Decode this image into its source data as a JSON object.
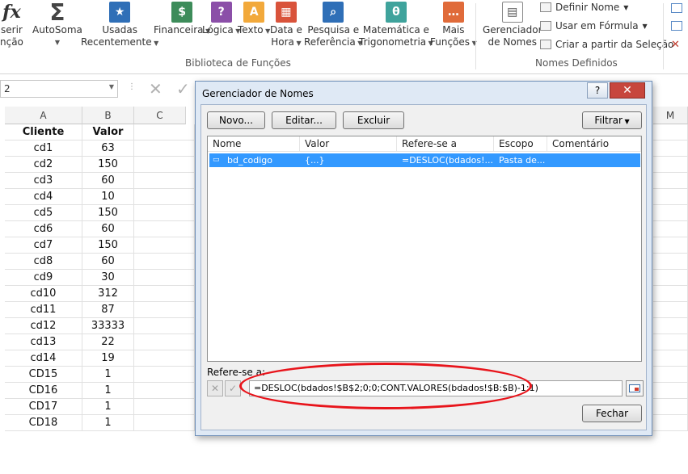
{
  "ribbon": {
    "insert_function": {
      "line1": "serir",
      "line2": "nção"
    },
    "autosum": {
      "label": "AutoSoma"
    },
    "recent": {
      "line1": "Usadas",
      "line2": "Recentemente"
    },
    "financial": {
      "label": "Financeira"
    },
    "logical": {
      "label": "Lógica"
    },
    "text": {
      "label": "Texto"
    },
    "datetime": {
      "line1": "Data e",
      "line2": "Hora"
    },
    "lookup": {
      "line1": "Pesquisa e",
      "line2": "Referência"
    },
    "math": {
      "line1": "Matemática e",
      "line2": "Trigonometria"
    },
    "more": {
      "line1": "Mais",
      "line2": "Funções"
    },
    "library_group_label": "Biblioteca de Funções",
    "name_manager": {
      "line1": "Gerenciador",
      "line2": "de Nomes"
    },
    "define_name": "Definir Nome",
    "use_in_formula": "Usar em Fórmula",
    "create_from_selection": "Criar a partir da Seleção",
    "names_group_label": "Nomes Definidos"
  },
  "formula_bar": {
    "name_box": "2"
  },
  "columns": [
    "A",
    "B",
    "C",
    "M"
  ],
  "sheet": {
    "header": {
      "col_a": "Cliente",
      "col_b": "Valor"
    },
    "rows": [
      {
        "a": "cd1",
        "b": "63"
      },
      {
        "a": "cd2",
        "b": "150"
      },
      {
        "a": "cd3",
        "b": "60"
      },
      {
        "a": "cd4",
        "b": "10"
      },
      {
        "a": "cd5",
        "b": "150"
      },
      {
        "a": "cd6",
        "b": "60"
      },
      {
        "a": "cd7",
        "b": "150"
      },
      {
        "a": "cd8",
        "b": "60"
      },
      {
        "a": "cd9",
        "b": "30"
      },
      {
        "a": "cd10",
        "b": "312"
      },
      {
        "a": "cd11",
        "b": "87"
      },
      {
        "a": "cd12",
        "b": "33333"
      },
      {
        "a": "cd13",
        "b": "22"
      },
      {
        "a": "cd14",
        "b": "19"
      },
      {
        "a": "CD15",
        "b": "1"
      },
      {
        "a": "CD16",
        "b": "1"
      },
      {
        "a": "CD17",
        "b": "1"
      },
      {
        "a": "CD18",
        "b": "1"
      }
    ]
  },
  "dialog": {
    "title": "Gerenciador de Nomes",
    "help": "?",
    "close": "✕",
    "buttons": {
      "new": "Novo...",
      "edit": "Editar...",
      "delete": "Excluir",
      "filter": "Filtrar"
    },
    "columns": {
      "name": "Nome",
      "value": "Valor",
      "refers": "Refere-se a",
      "scope": "Escopo",
      "comment": "Comentário"
    },
    "names": [
      {
        "name": "bd_codigo",
        "value": "{...}",
        "refers": "=DESLOC(bdados!...",
        "scope": "Pasta de..."
      }
    ],
    "refers_label": "Refere-se a:",
    "refers_value": "=DESLOC(bdados!$B$2;0;0;CONT.VALORES(bdados!$B:$B)-1;1)",
    "close_button": "Fechar"
  },
  "colors": {
    "highlight_row": "#3399ff",
    "annotation_ellipse": "#e8141b"
  }
}
